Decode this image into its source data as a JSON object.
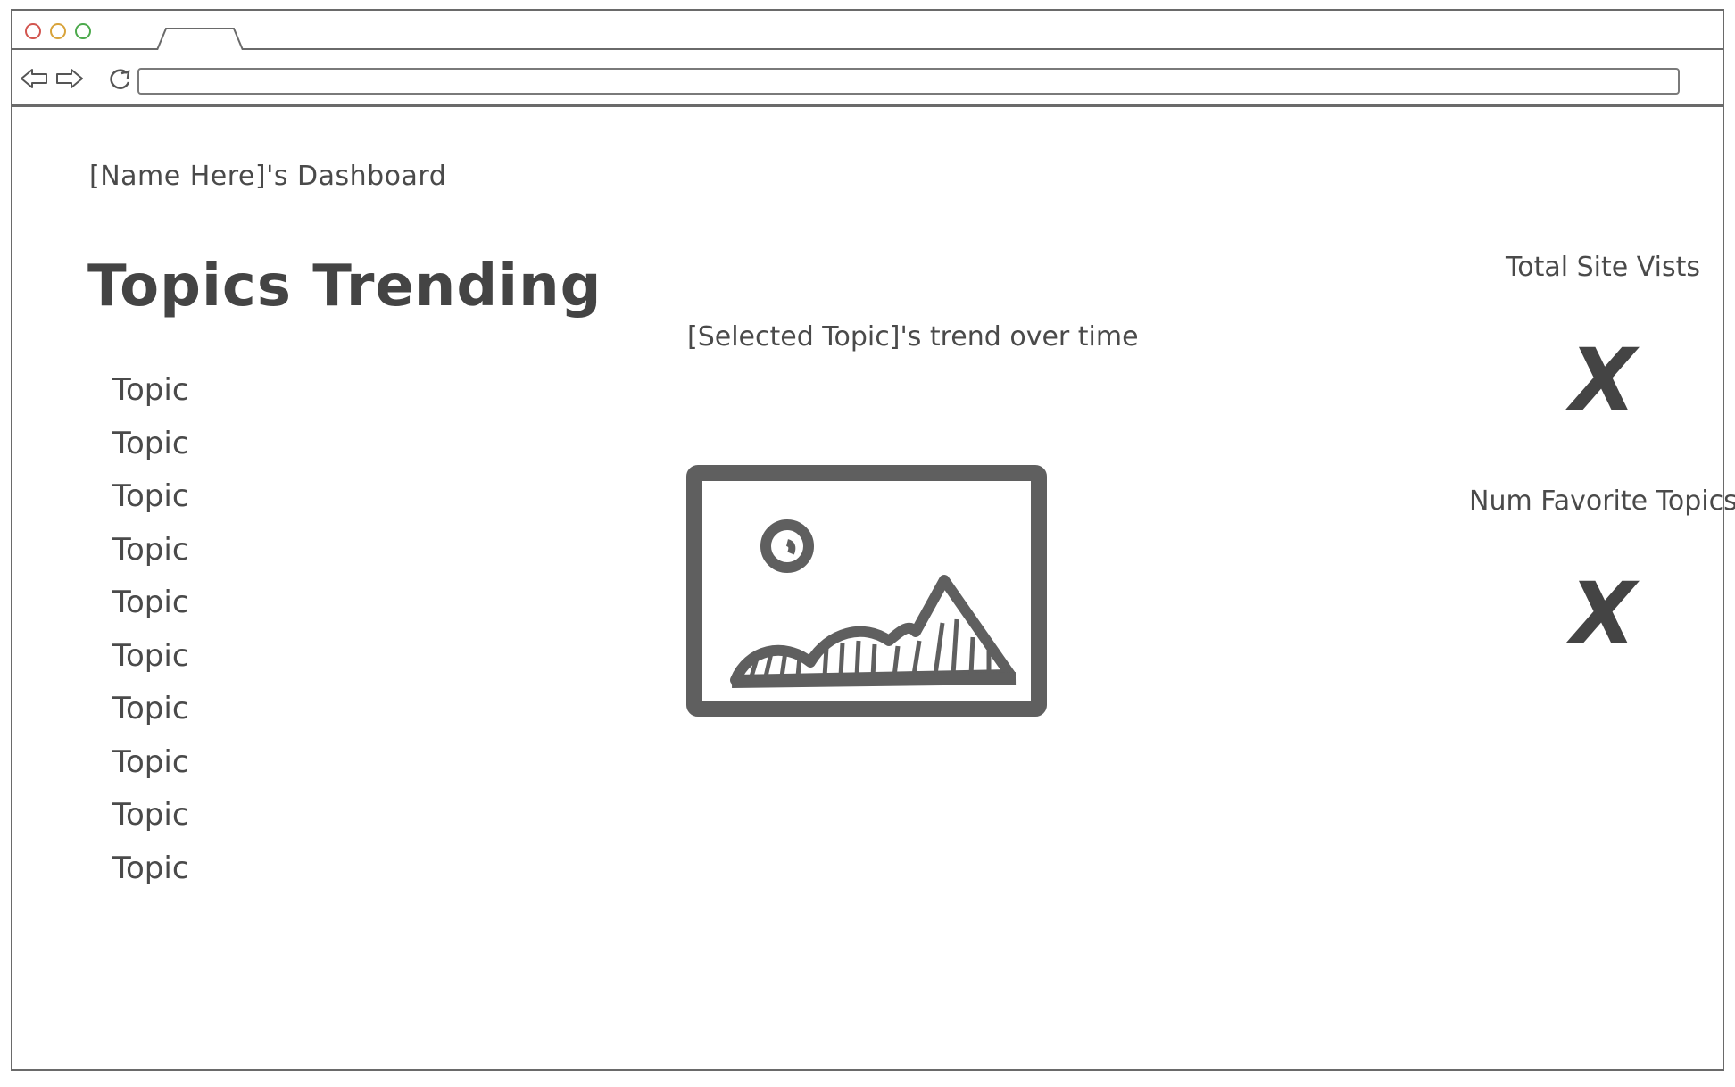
{
  "window": {
    "controls": [
      "close",
      "minimize",
      "maximize"
    ],
    "colors": {
      "close": "#d2554f",
      "minimize": "#d8a33a",
      "maximize": "#4ca94c"
    }
  },
  "browser": {
    "back_icon": "arrow-left-icon",
    "forward_icon": "arrow-right-icon",
    "reload_icon": "reload-icon",
    "url": ""
  },
  "dashboard": {
    "title": "[Name Here]'s Dashboard"
  },
  "trending": {
    "heading": "Topics Trending",
    "topics": [
      "Topic",
      "Topic",
      "Topic",
      "Topic",
      "Topic",
      "Topic",
      "Topic",
      "Topic",
      "Topic",
      "Topic"
    ]
  },
  "chart": {
    "caption": "[Selected Topic]'s trend over time",
    "placeholder_icon": "image-placeholder-icon"
  },
  "stats": {
    "total_site_visits_label": "Total Site Vists",
    "total_site_visits_value": "X",
    "num_favorite_topics_label": "Num Favorite Topics",
    "num_favorite_topics_value": "X"
  },
  "colors": {
    "ink": "#4a4a4a",
    "frame": "#6a6a6a"
  }
}
